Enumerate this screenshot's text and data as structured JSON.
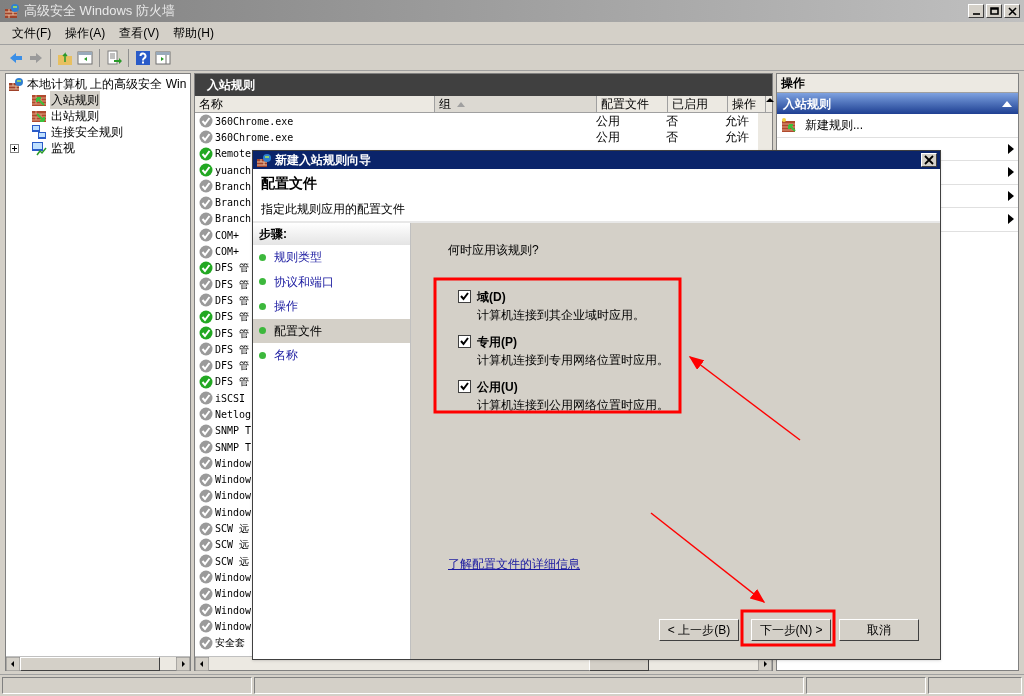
{
  "window": {
    "title": "高级安全 Windows 防火墙"
  },
  "menu": [
    "文件(F)",
    "操作(A)",
    "查看(V)",
    "帮助(H)"
  ],
  "tree": {
    "label": "本地计算机 上的高级安全 Win",
    "children": [
      {
        "label": "入站规则",
        "selected": true,
        "kind": "inbound"
      },
      {
        "label": "出站规则",
        "selected": false,
        "kind": "outbound"
      },
      {
        "label": "连接安全规则",
        "selected": false,
        "kind": "connection"
      },
      {
        "label": "监视",
        "selected": false,
        "kind": "monitor",
        "expanded": false
      }
    ]
  },
  "rules_pane": {
    "title": "入站规则",
    "columns": [
      {
        "label": "名称",
        "sorted": false
      },
      {
        "label": "组",
        "sorted": true
      },
      {
        "label": "配置文件",
        "sorted": false
      },
      {
        "label": "已启用",
        "sorted": false
      },
      {
        "label": "操作",
        "sorted": false
      }
    ],
    "rows": [
      {
        "name": "360Chrome.exe",
        "enabled": false,
        "profile": "公用",
        "enabled_text": "否",
        "action": "允许"
      },
      {
        "name": "360Chrome.exe",
        "enabled": false,
        "profile": "公用",
        "enabled_text": "否",
        "action": "允许"
      },
      {
        "name": "Remote",
        "enabled": true
      },
      {
        "name": "yuanch",
        "enabled": true
      },
      {
        "name": "Branch",
        "enabled": false
      },
      {
        "name": "Branch",
        "enabled": false
      },
      {
        "name": "Branch",
        "enabled": false
      },
      {
        "name": "COM+",
        "enabled": false
      },
      {
        "name": "COM+",
        "enabled": false
      },
      {
        "name": "DFS 管",
        "enabled": true
      },
      {
        "name": "DFS 管",
        "enabled": false
      },
      {
        "name": "DFS 管",
        "enabled": false
      },
      {
        "name": "DFS 管",
        "enabled": true
      },
      {
        "name": "DFS 管",
        "enabled": true
      },
      {
        "name": "DFS 管",
        "enabled": false
      },
      {
        "name": "DFS 管",
        "enabled": false
      },
      {
        "name": "DFS 管",
        "enabled": true
      },
      {
        "name": "iSCSI",
        "enabled": false
      },
      {
        "name": "Netlog",
        "enabled": false
      },
      {
        "name": "SNMP T",
        "enabled": false
      },
      {
        "name": "SNMP T",
        "enabled": false
      },
      {
        "name": "Window",
        "enabled": false
      },
      {
        "name": "Window",
        "enabled": false
      },
      {
        "name": "Window",
        "enabled": false
      },
      {
        "name": "Window",
        "enabled": false
      },
      {
        "name": "SCW 远",
        "enabled": false
      },
      {
        "name": "SCW 远",
        "enabled": false
      },
      {
        "name": "SCW 远",
        "enabled": false
      },
      {
        "name": "Window",
        "enabled": false
      },
      {
        "name": "Window",
        "enabled": false
      },
      {
        "name": "Window",
        "enabled": false
      },
      {
        "name": "Window",
        "enabled": false
      },
      {
        "name": "安全套",
        "enabled": false
      }
    ]
  },
  "actions_pane": {
    "title": "操作",
    "section": "入站规则",
    "items": [
      {
        "kind": "command",
        "label": "新建规则..."
      },
      {
        "kind": "submenu"
      },
      {
        "kind": "submenu"
      },
      {
        "kind": "submenu"
      },
      {
        "kind": "submenu"
      }
    ]
  },
  "dialog": {
    "title": "新建入站规则向导",
    "heading": "配置文件",
    "subheading": "指定此规则应用的配置文件",
    "steps_title": "步骤:",
    "steps": [
      {
        "label": "规则类型",
        "selected": false
      },
      {
        "label": "协议和端口",
        "selected": false
      },
      {
        "label": "操作",
        "selected": false
      },
      {
        "label": "配置文件",
        "selected": true
      },
      {
        "label": "名称",
        "selected": false
      }
    ],
    "question": "何时应用该规则?",
    "profiles": [
      {
        "label": "域(D)",
        "description": "计算机连接到其企业域时应用。",
        "checked": true
      },
      {
        "label": "专用(P)",
        "description": "计算机连接到专用网络位置时应用。",
        "checked": true
      },
      {
        "label": "公用(U)",
        "description": "计算机连接到公用网络位置时应用。",
        "checked": true
      }
    ],
    "link": "了解配置文件的详细信息",
    "buttons": [
      {
        "label": "< 上一步(B)",
        "kind": "back"
      },
      {
        "label": "下一步(N) >",
        "kind": "next"
      },
      {
        "label": "取消",
        "kind": "cancel"
      }
    ]
  }
}
